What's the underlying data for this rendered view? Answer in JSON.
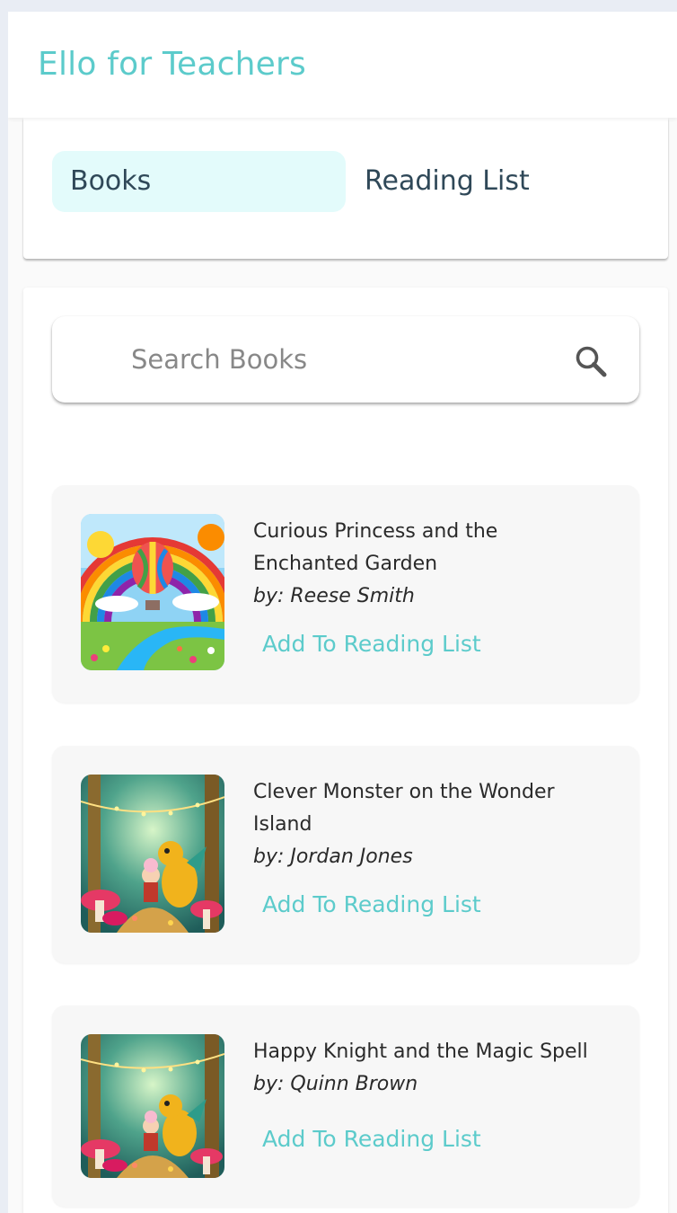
{
  "header": {
    "title": "Ello for Teachers"
  },
  "tabs": [
    {
      "label": "Books",
      "active": true
    },
    {
      "label": "Reading List",
      "active": false
    }
  ],
  "search": {
    "placeholder": "Search Books",
    "value": "",
    "icon": "search-icon"
  },
  "books": [
    {
      "title_line1": "Curious Princess and the",
      "title_line2": "Enchanted Garden",
      "author": "by: Reese Smith",
      "action": "Add To Reading List",
      "cover": "rainbow-balloon-cover"
    },
    {
      "title_line1": "Clever Monster on the Wonder",
      "title_line2": "Island",
      "author": "by: Jordan Jones",
      "action": "Add To Reading List",
      "cover": "forest-dragon-cover"
    },
    {
      "title_line1": "Happy Knight and the Magic Spell",
      "title_line2": "",
      "author": "by: Quinn Brown",
      "action": "Add To Reading List",
      "cover": "forest-dragon-cover"
    }
  ],
  "colors": {
    "brand": "#5ccbcb",
    "active_tab_bg": "#e3fbfb",
    "tab_text": "#2f4858",
    "card_bg": "#f7f7f7"
  }
}
